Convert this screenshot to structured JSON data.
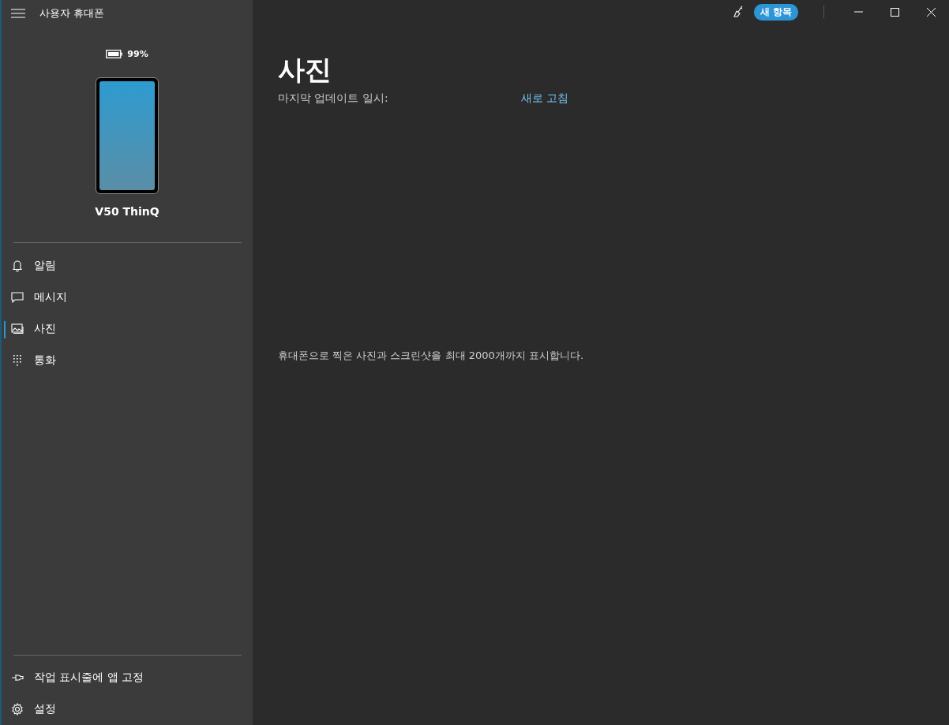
{
  "app": {
    "title": "사용자 휴대폰"
  },
  "device": {
    "battery": "99%",
    "name": "V50 ThinQ"
  },
  "nav_items": [
    {
      "label": "알림",
      "kind": "bell",
      "selected": false
    },
    {
      "label": "메시지",
      "kind": "message",
      "selected": false
    },
    {
      "label": "사진",
      "kind": "photo",
      "selected": true
    },
    {
      "label": "통화",
      "kind": "dialpad",
      "selected": false
    }
  ],
  "footer_items": [
    {
      "label": "작업 표시줄에 앱 고정",
      "kind": "pin"
    },
    {
      "label": "설정",
      "kind": "gear"
    }
  ],
  "title_bar": {
    "badge": "새 항목"
  },
  "page": {
    "heading": "사진",
    "last_update_label": "마지막 업데이트 일시:",
    "refresh_link": "새로 고침",
    "message": "휴대폰으로 찍은 사진과 스크린샷을 최대 2000개까지 표시합니다."
  }
}
